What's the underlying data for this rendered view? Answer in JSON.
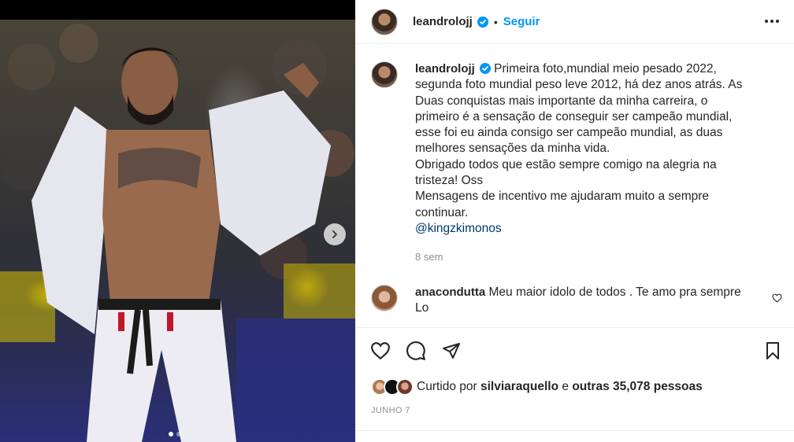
{
  "post": {
    "username": "leandrolojj",
    "follow_label": "Seguir",
    "separator": "•",
    "verified": true
  },
  "caption": {
    "username": "leandrolojj",
    "text_lines": [
      "Primeira foto,mundial meio pesado 2022,",
      "segunda foto mundial peso leve 2012, há dez anos atrás. As",
      "Duas conquistas mais importante da minha carreira, o",
      "primeiro é a sensação de conseguir ser campeão mundial,",
      "esse foi eu ainda consigo ser campeão mundial, as duas",
      "melhores sensações da minha vida.",
      "Obrigado todos que estão sempre comigo na alegria na",
      "tristeza! Oss",
      "Mensagens de incentivo me ajudaram muito a sempre",
      "continuar."
    ],
    "mention": "@kingzkimonos",
    "time_ago": "8 sem"
  },
  "comment": {
    "username": "anacondutta",
    "text": "Meu maior idolo de todos . Te amo pra sempre",
    "text_cont": "Lo"
  },
  "likes": {
    "prefix": "Curtido por",
    "user": "silviaraquello",
    "connector": "e",
    "others": "outras 35,078 pessoas"
  },
  "date": "JUNHO 7",
  "carousel": {
    "total": 2,
    "active": 0
  },
  "colors": {
    "accent": "#0095f6",
    "verified": "#0095f6",
    "mention": "#00376b",
    "muted": "#8e8e8e"
  },
  "icons": {
    "more": "more-horizontal-icon",
    "like": "heart-icon",
    "comment": "comment-icon",
    "share": "share-icon",
    "save": "bookmark-icon",
    "next": "chevron-right-icon"
  }
}
